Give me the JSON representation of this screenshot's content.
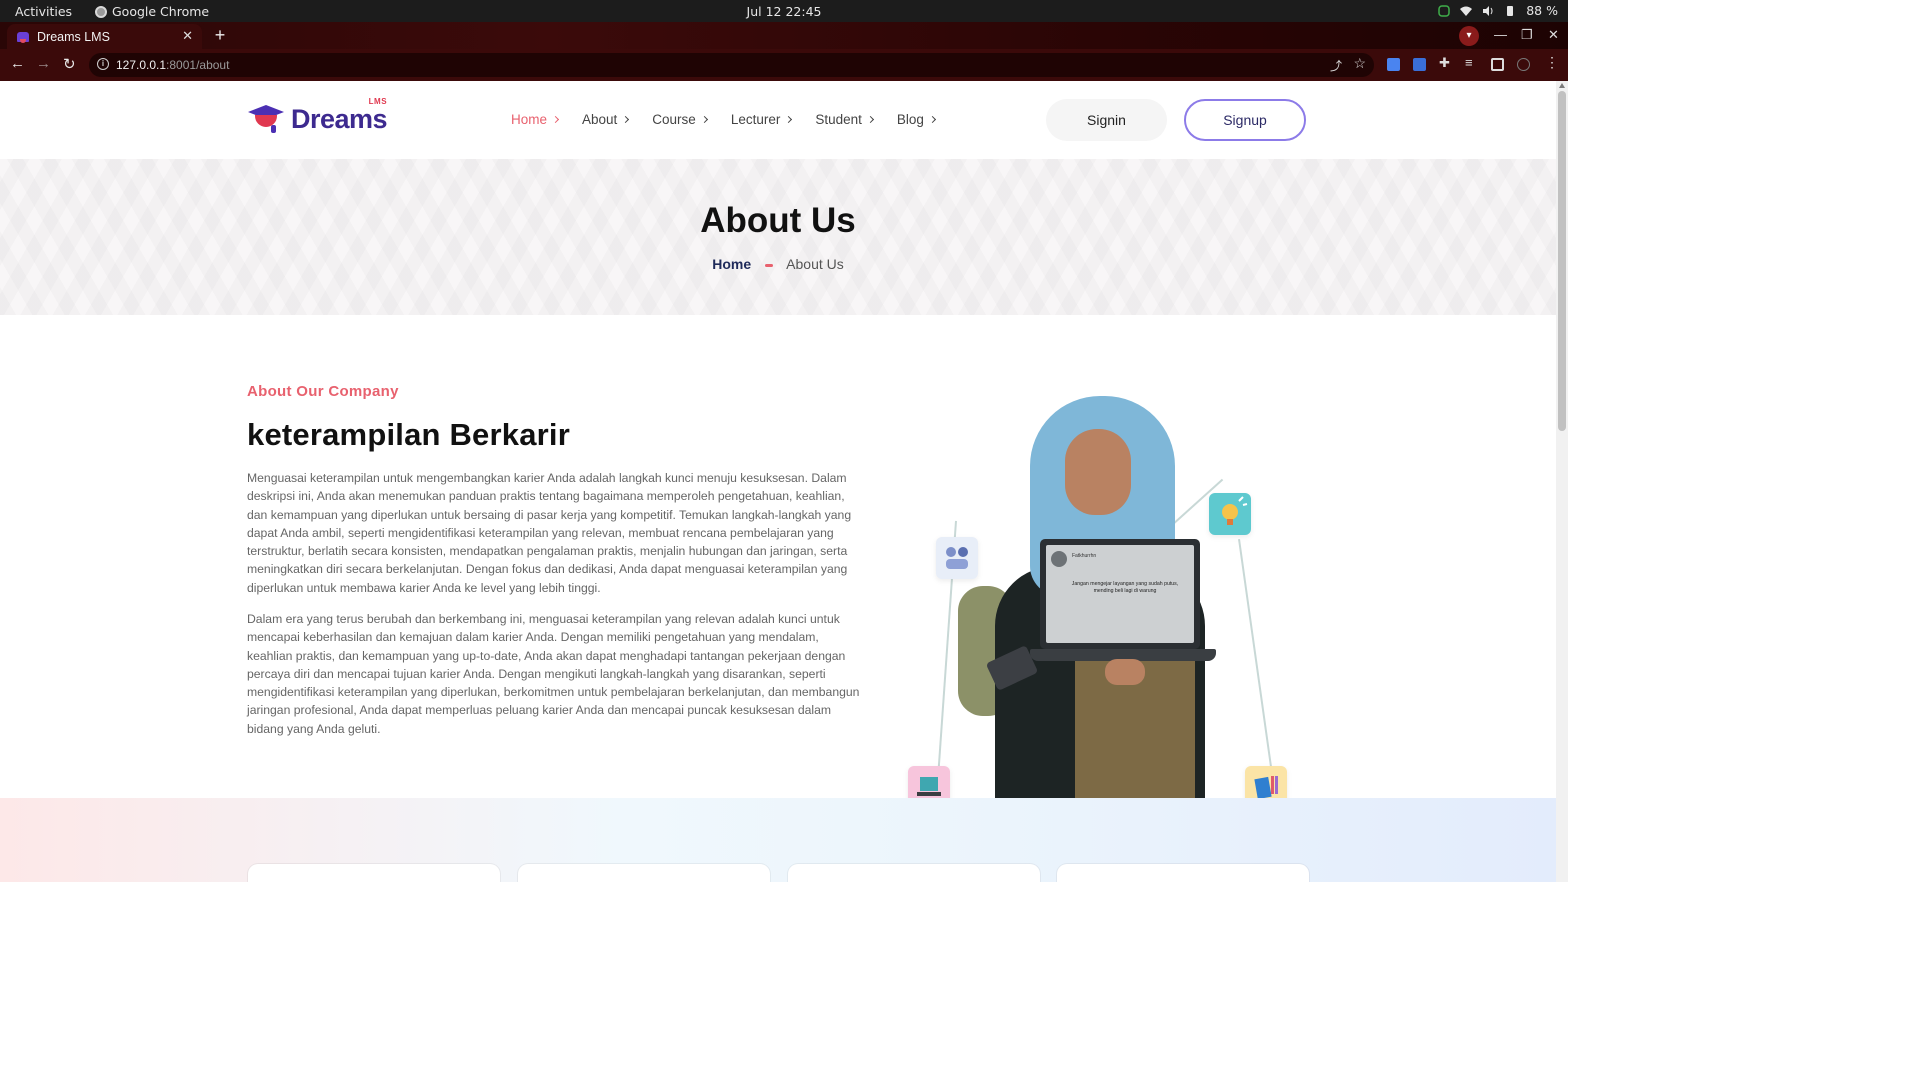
{
  "os": {
    "activities": "Activities",
    "app_name": "Google Chrome",
    "clock": "Jul 12  22:45",
    "battery": "88 %"
  },
  "browser": {
    "tab_title": "Dreams LMS",
    "url_host": "127.0.0.1",
    "url_rest": ":8001/about"
  },
  "site": {
    "logo_text": "Dreams",
    "logo_sup": "LMS",
    "menu": [
      {
        "label": "Home"
      },
      {
        "label": "About"
      },
      {
        "label": "Course"
      },
      {
        "label": "Lecturer"
      },
      {
        "label": "Student"
      },
      {
        "label": "Blog"
      }
    ],
    "signin": "Signin",
    "signup": "Signup",
    "hero_title": "About Us",
    "breadcrumb_home": "Home",
    "breadcrumb_current": "About Us",
    "eyebrow": "About Our Company",
    "heading": "keterampilan Berkarir",
    "paragraph1": "Menguasai keterampilan untuk mengembangkan karier Anda adalah langkah kunci menuju kesuksesan. Dalam deskripsi ini, Anda akan menemukan panduan praktis tentang bagaimana memperoleh pengetahuan, keahlian, dan kemampuan yang diperlukan untuk bersaing di pasar kerja yang kompetitif. Temukan langkah-langkah yang dapat Anda ambil, seperti mengidentifikasi keterampilan yang relevan, membuat rencana pembelajaran yang terstruktur, berlatih secara konsisten, mendapatkan pengalaman praktis, menjalin hubungan dan jaringan, serta meningkatkan diri secara berkelanjutan. Dengan fokus dan dedikasi, Anda dapat menguasai keterampilan yang diperlukan untuk membawa karier Anda ke level yang lebih tinggi.",
    "paragraph2": "Dalam era yang terus berubah dan berkembang ini, menguasai keterampilan yang relevan adalah kunci untuk mencapai keberhasilan dan kemajuan dalam karier Anda. Dengan memiliki pengetahuan yang mendalam, keahlian praktis, dan kemampuan yang up-to-date, Anda akan dapat menghadapi tantangan pekerjaan dengan percaya diri dan mencapai tujuan karier Anda. Dengan mengikuti langkah-langkah yang disarankan, seperti mengidentifikasi keterampilan yang diperlukan, berkomitmen untuk pembelajaran berkelanjutan, dan membangun jaringan profesional, Anda dapat memperluas peluang karier Anda dan mencapai puncak kesuksesan dalam bidang yang Anda geluti.",
    "laptop_name": "Fatkhurrhn",
    "laptop_quote": "Jangan mengejar layangan yang sudah putus, mending beli lagi di warung"
  },
  "colors": {
    "accent": "#e8616e",
    "brand": "#3d2a8f",
    "signup_border": "#8c7be8"
  }
}
